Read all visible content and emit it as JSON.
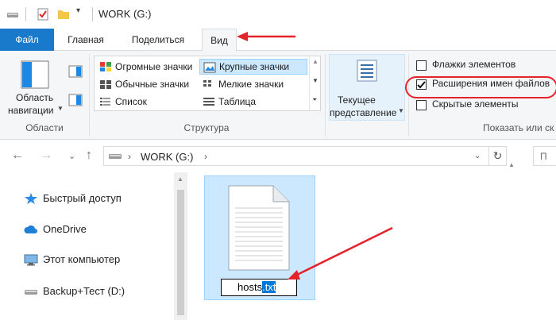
{
  "window": {
    "title": "WORK (G:)"
  },
  "tabs": [
    {
      "label": "Файл"
    },
    {
      "label": "Главная"
    },
    {
      "label": "Поделиться"
    },
    {
      "label": "Вид"
    }
  ],
  "ribbon": {
    "panes": {
      "nav_pane_label_line1": "Область",
      "nav_pane_label_line2": "навигации",
      "group_label": "Области"
    },
    "layout": {
      "items": [
        {
          "label": "Огромные значки"
        },
        {
          "label": "Крупные значки",
          "selected": true
        },
        {
          "label": "Обычные значки"
        },
        {
          "label": "Мелкие значки"
        },
        {
          "label": "Список"
        },
        {
          "label": "Таблица"
        }
      ],
      "group_label": "Структура"
    },
    "current_view": {
      "label_line1": "Текущее",
      "label_line2": "представление"
    },
    "show_hide": {
      "items": [
        {
          "label": "Флажки элементов",
          "checked": false
        },
        {
          "label": "Расширения имен файлов",
          "checked": true
        },
        {
          "label": "Скрытые элементы",
          "checked": false
        }
      ],
      "group_label": "Показать или ск"
    }
  },
  "address": {
    "path": "WORK (G:)",
    "search_placeholder": "П"
  },
  "nav_pane": {
    "items": [
      {
        "label": "Быстрый доступ",
        "icon": "star-icon"
      },
      {
        "label": "OneDrive",
        "icon": "cloud-icon"
      },
      {
        "label": "Этот компьютер",
        "icon": "computer-icon"
      },
      {
        "label": "Backup+Тест (D:)",
        "icon": "drive-icon"
      }
    ]
  },
  "content": {
    "file": {
      "name_base": "hosts",
      "name_ext_selected": ".txt"
    }
  },
  "colors": {
    "accent": "#1979ca",
    "selection": "#cce8ff",
    "annotation": "#e4232b"
  }
}
